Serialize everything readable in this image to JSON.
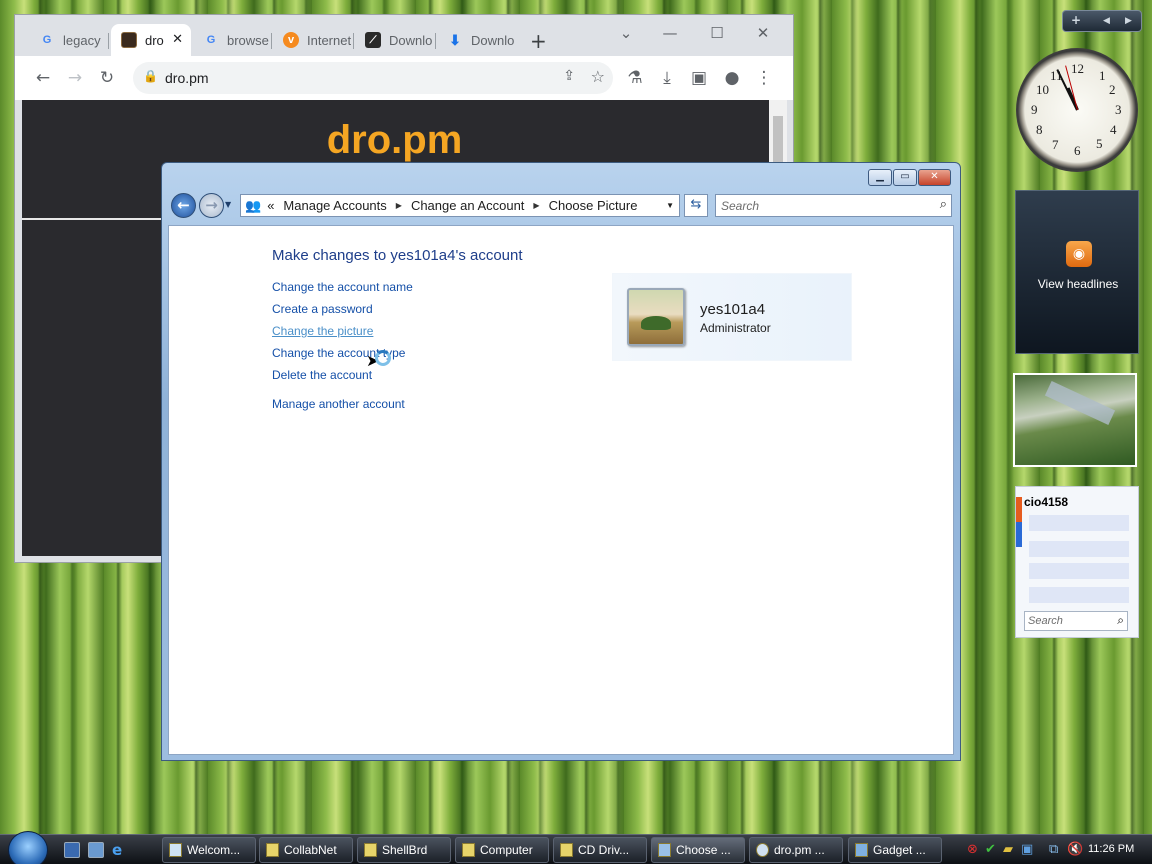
{
  "browser": {
    "tabs": [
      {
        "label": "legacy",
        "icon": "google-icon"
      },
      {
        "label": "dro",
        "icon": "site-favicon"
      },
      {
        "label": "browse",
        "icon": "google-icon"
      },
      {
        "label": "Internet",
        "icon": "firefox-icon"
      },
      {
        "label": "Downlo",
        "icon": "download-site-icon"
      },
      {
        "label": "Downlo",
        "icon": "download-icon"
      }
    ],
    "new_tab": "+",
    "url": "dro.pm",
    "page_title": "dro.pm"
  },
  "control_panel": {
    "breadcrumb_prefix": "«",
    "breadcrumbs": [
      "Manage Accounts",
      "Change an Account",
      "Choose Picture"
    ],
    "search_placeholder": "Search",
    "heading": "Make changes to yes101a4's account",
    "tasks": [
      "Change the account name",
      "Create a password",
      "Change the picture",
      "Change the account type",
      "Delete the account"
    ],
    "manage_other": "Manage another account",
    "account_name": "yes101a4",
    "account_role": "Administrator"
  },
  "gadgets": {
    "clock_numbers": [
      "12",
      "1",
      "2",
      "3",
      "4",
      "5",
      "6",
      "7",
      "8",
      "9",
      "10",
      "11"
    ],
    "feed_label": "View headlines",
    "contacts_title": "cio4158",
    "contacts_search": "Search"
  },
  "taskbar": {
    "buttons": [
      "Welcom...",
      "CollabNet",
      "ShellBrd",
      "Computer",
      "CD Driv...",
      "Choose ...",
      "dro.pm ...",
      "Gadget ..."
    ],
    "time": "11:26 PM"
  }
}
